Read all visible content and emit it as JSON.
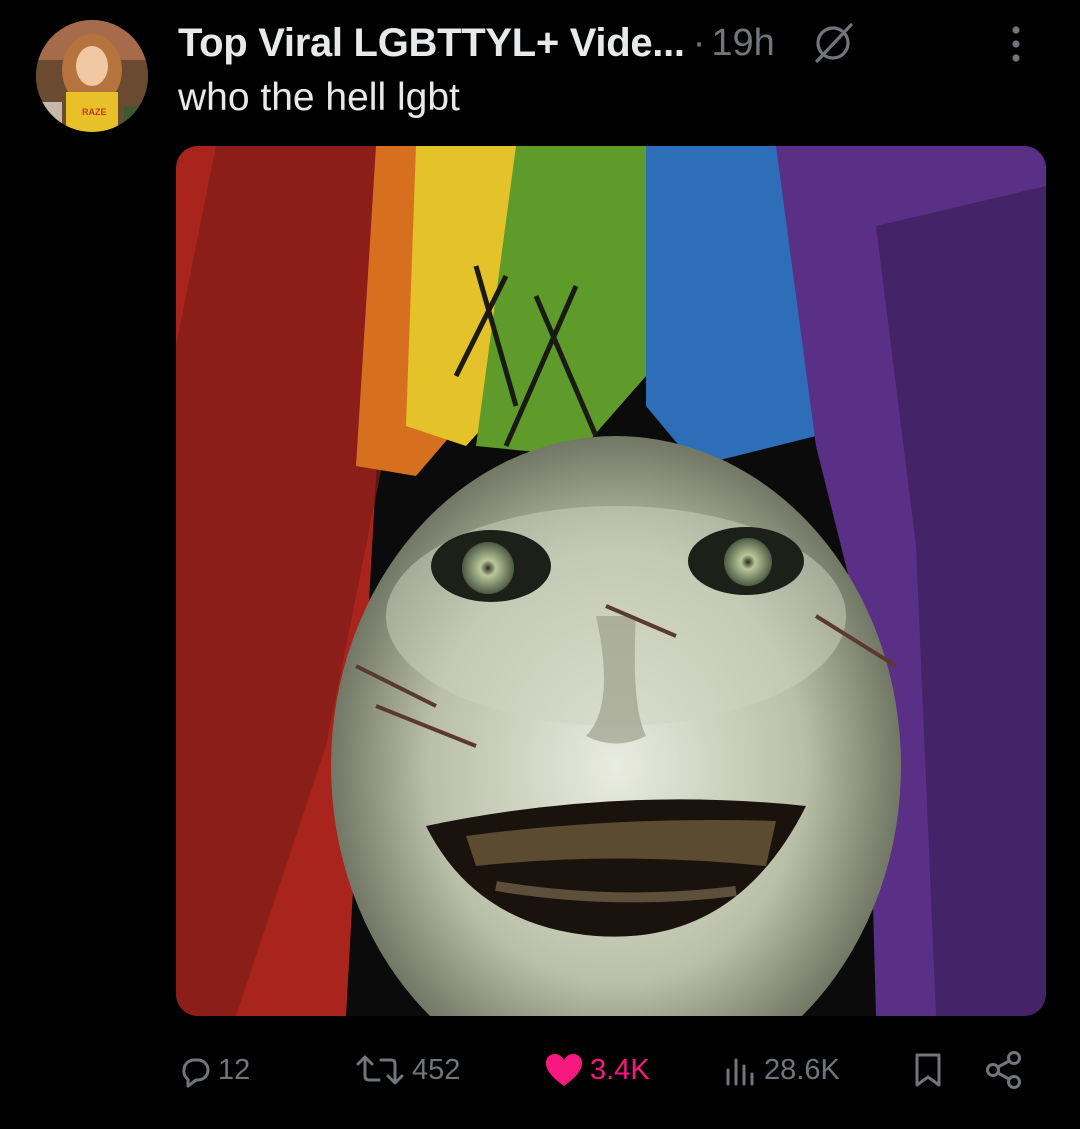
{
  "post": {
    "author_name": "Top Viral LGBTTYL+ Vide...",
    "separator": "·",
    "time_ago": "19h",
    "text": "who the hell lgbt",
    "icons": {
      "grok": "grok-icon",
      "more": "more-icon",
      "reply": "reply-icon",
      "repost": "repost-icon",
      "like": "heart-icon",
      "views": "views-icon",
      "bookmark": "bookmark-icon",
      "share": "share-icon"
    },
    "avatar_badge_text": "RAZE"
  },
  "actions": {
    "replies": "12",
    "reposts": "452",
    "likes": "3.4K",
    "views": "28.6K"
  },
  "colors": {
    "background": "#000000",
    "text_primary": "#e7e9ea",
    "text_secondary": "#71767b",
    "like_active": "#f91880"
  }
}
